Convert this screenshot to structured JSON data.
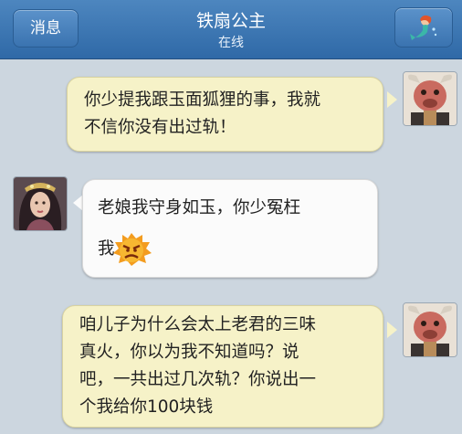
{
  "header": {
    "back_label": "消息",
    "contact_name": "铁扇公主",
    "status": "在线",
    "profile_icon": "mermaid-icon"
  },
  "messages": [
    {
      "side": "right",
      "sender": "self",
      "text": "你少提我跟玉面狐狸的事，我就\n不信你没有出过轨！"
    },
    {
      "side": "left",
      "sender": "contact",
      "text": "老娘我守身如玉，你少冤枉",
      "emoji_prefix": "我",
      "emoji": "angry-face-emoji"
    },
    {
      "side": "right",
      "sender": "self",
      "text": "咱儿子为什么会太上老君的三味\n真火，你以为我不知道吗？说\n吧，一共出过几次轨？你说出一\n个我给你100块钱"
    }
  ],
  "colors": {
    "header": "#3a73b0",
    "background": "#ccd6df",
    "outgoing_bubble": "#f6f2c8",
    "incoming_bubble": "#fbfbfb"
  }
}
